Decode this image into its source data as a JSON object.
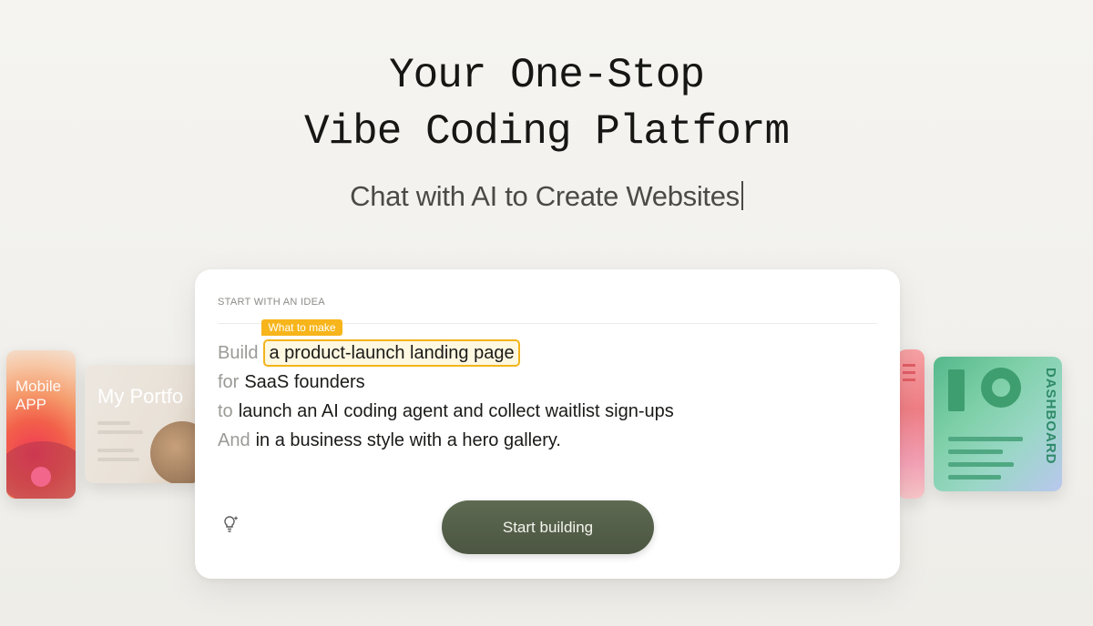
{
  "hero": {
    "title_line1": "Your One-Stop",
    "title_line2": "Vibe Coding Platform",
    "subtitle": "Chat with AI to Create Websites"
  },
  "cards": {
    "mobile_app": {
      "line1": "Mobile",
      "line2": "APP"
    },
    "portfolio": {
      "title": "My Portfo"
    },
    "dashboard": {
      "label": "DASHBOARD"
    }
  },
  "prompt": {
    "section_label": "START WITH AN IDEA",
    "highlight_tag": "What to make",
    "rows": [
      {
        "keyword": "Build",
        "value": "a product-launch landing page"
      },
      {
        "keyword": "for",
        "value": "SaaS founders"
      },
      {
        "keyword": "to",
        "value": "launch an AI coding agent and collect waitlist sign-ups"
      },
      {
        "keyword": "And",
        "value": "in a business style with a hero gallery."
      }
    ],
    "start_button": "Start building"
  },
  "colors": {
    "highlight": "#f3b41a",
    "button": "#4f5a45",
    "background": "#f3f2ee"
  },
  "icons": {
    "idea": "lightbulb-sparkle-icon"
  }
}
